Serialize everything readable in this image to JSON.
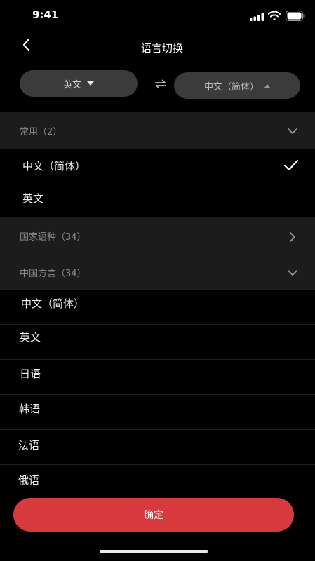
{
  "status_bar": {
    "time": "9:41"
  },
  "nav": {
    "title": "语言切换"
  },
  "selector": {
    "source_label": "英文",
    "target_label": "中文（简体）"
  },
  "sections": {
    "common": {
      "label": "常用（2）",
      "items": [
        {
          "label": "中文（简体）",
          "selected": true
        },
        {
          "label": "英文",
          "selected": false
        }
      ]
    },
    "national": {
      "label": "国家语种（34）"
    },
    "dialect": {
      "label": "中国方言（34）",
      "items": [
        {
          "label": "中文（简体）"
        },
        {
          "label": "英文"
        },
        {
          "label": "日语"
        },
        {
          "label": "韩语"
        },
        {
          "label": "法语"
        },
        {
          "label": "俄语"
        }
      ]
    }
  },
  "confirm_label": "确定",
  "colors": {
    "background": "#000000",
    "section_bg": "#1c1c1c",
    "pill_bg": "#3b3b3b",
    "accent": "#d63a3c"
  }
}
